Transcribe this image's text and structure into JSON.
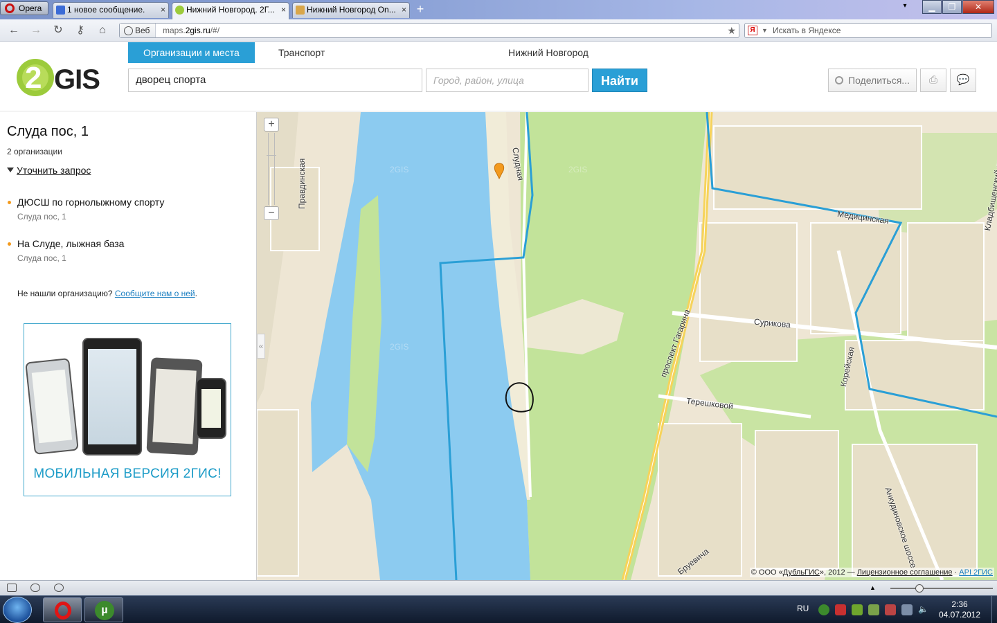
{
  "browser": {
    "opera_label": "Opera",
    "tabs": [
      {
        "label": "1 новое сообщение.",
        "close": "×"
      },
      {
        "label": "Нижний Новгород. 2Г...",
        "close": "×"
      },
      {
        "label": "Нижний Новгород On...",
        "close": "×"
      }
    ],
    "new_tab": "+",
    "address": {
      "mode": "Веб",
      "host": "maps.",
      "domain": "2gis.ru",
      "path": "/#/"
    },
    "search_placeholder": "Искать в Яндексе",
    "search_engine_icon": "Я"
  },
  "header": {
    "logo_digit": "2",
    "logo_text": "GIS",
    "tabs": [
      "Организации и места",
      "Транспорт"
    ],
    "city": "Нижний Новгород",
    "search_value": "дворец спорта",
    "city_placeholder": "Город, район, улица",
    "find_label": "Найти",
    "share_label": "Поделиться...",
    "accent_color": "#2a9fd6"
  },
  "panel": {
    "title": "Слуда пос, 1",
    "count": "2 организации",
    "refine": "Уточнить запрос",
    "results": [
      {
        "name": "ДЮСШ по горнолыжному спорту",
        "address": "Слуда пос, 1"
      },
      {
        "name": "На Слуде, лыжная база",
        "address": "Слуда пос, 1"
      }
    ],
    "not_found_text": "Не нашли организацию?",
    "not_found_link": "Сообщите нам о ней",
    "not_found_end": ".",
    "ad_caption": "МОБИЛЬНАЯ ВЕРСИЯ 2ГИС!"
  },
  "map": {
    "streets": [
      "Правдинская",
      "Слудная",
      "Медицинская",
      "Сурикова",
      "проспект Гагарина",
      "Корейская",
      "Терешковой",
      "Анкудиновское шоссе",
      "Бруевича",
      "Кладбищенский проезд"
    ],
    "watermark": "2GIS",
    "copyright_prefix": "© ООО «",
    "copyright_company": "ДубльГИС",
    "copyright_mid": "», 2012 — ",
    "copyright_license": "Лицензионное соглашение",
    "copyright_sep": " · ",
    "copyright_api": "API 2ГИС",
    "zoom_in": "+",
    "zoom_out": "−",
    "collapse": "«",
    "water_color": "#8ccbf0",
    "park_color": "#c2e39a",
    "route_color": "#2a9fd6"
  },
  "taskbar": {
    "lang": "RU",
    "time": "2:36",
    "date": "04.07.2012"
  }
}
